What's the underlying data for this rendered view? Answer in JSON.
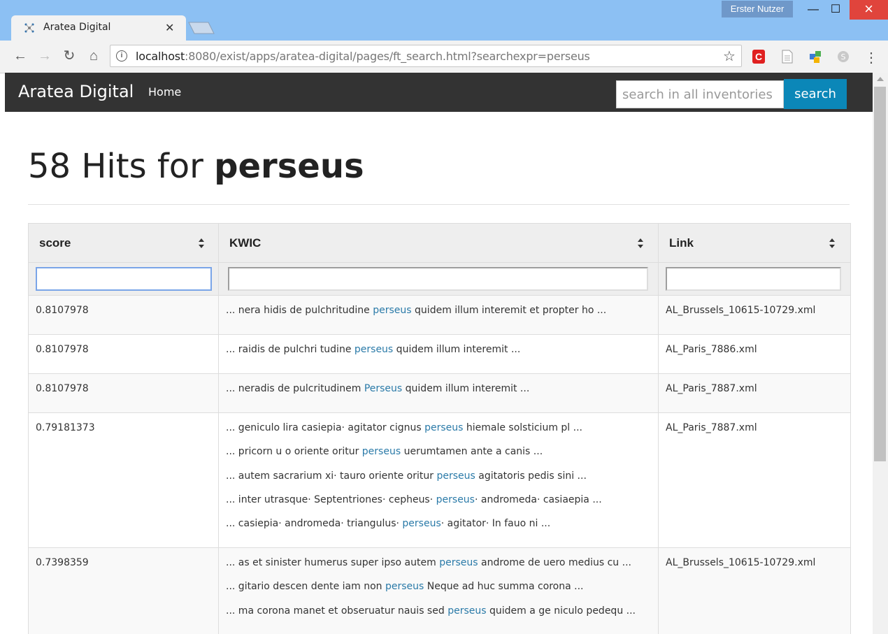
{
  "browser": {
    "user": "Erster Nutzer",
    "tab_title": "Aratea Digital",
    "url_host": "localhost",
    "url_rest": ":8080/exist/apps/aratea-digital/pages/ft_search.html?searchexpr=perseus"
  },
  "navbar": {
    "brand": "Aratea Digital",
    "home": "Home",
    "search_placeholder": "search in all inventories",
    "search_button": "search"
  },
  "heading": {
    "prefix": "58 Hits for ",
    "term": "perseus"
  },
  "table": {
    "columns": [
      "score",
      "KWIC",
      "Link"
    ],
    "rows": [
      {
        "score": "0.8107978",
        "link": "AL_Brussels_10615-10729.xml",
        "kwic": [
          {
            "pre": "... nera hidis de pulchritudine ",
            "hit": "perseus",
            "post": " quidem illum interemit et propter ho ..."
          }
        ]
      },
      {
        "score": "0.8107978",
        "link": "AL_Paris_7886.xml",
        "kwic": [
          {
            "pre": "... raidis de pulchri tudine ",
            "hit": "perseus",
            "post": " quidem illum interemit ..."
          }
        ]
      },
      {
        "score": "0.8107978",
        "link": "AL_Paris_7887.xml",
        "kwic": [
          {
            "pre": "... neradis de pulcritudinem ",
            "hit": "Perseus",
            "post": " quidem illum interemit ..."
          }
        ]
      },
      {
        "score": "0.79181373",
        "link": "AL_Paris_7887.xml",
        "kwic": [
          {
            "pre": "... geniculo lira casiepia· agitator cignus ",
            "hit": "perseus",
            "post": " hiemale solsticium pl ..."
          },
          {
            "pre": "... pricorn u o oriente oritur ",
            "hit": "perseus",
            "post": " uerumtamen ante a canis ..."
          },
          {
            "pre": "... autem sacrarium xi· tauro oriente oritur ",
            "hit": "perseus",
            "post": " agitatoris pedis sini ..."
          },
          {
            "pre": "... inter utrasque· Septentriones· cepheus· ",
            "hit": "perseus",
            "post": "· andromeda· casiaepia ..."
          },
          {
            "pre": "... casiepia· andromeda· triangulus· ",
            "hit": "perseus",
            "post": "· agitator· In fauo ni ..."
          }
        ]
      },
      {
        "score": "0.7398359",
        "link": "AL_Brussels_10615-10729.xml",
        "kwic": [
          {
            "pre": "... as et sinister humerus super ipso autem ",
            "hit": "perseus",
            "post": " androme de uero medius cu ..."
          },
          {
            "pre": "... gitario descen dente iam non ",
            "hit": "perseus",
            "post": " Neque ad huc summa corona ..."
          },
          {
            "pre": "... ma corona manet et obseruatur nauis sed ",
            "hit": "perseus",
            "post": " quidem a ge niculo pedequ ..."
          }
        ]
      }
    ]
  }
}
